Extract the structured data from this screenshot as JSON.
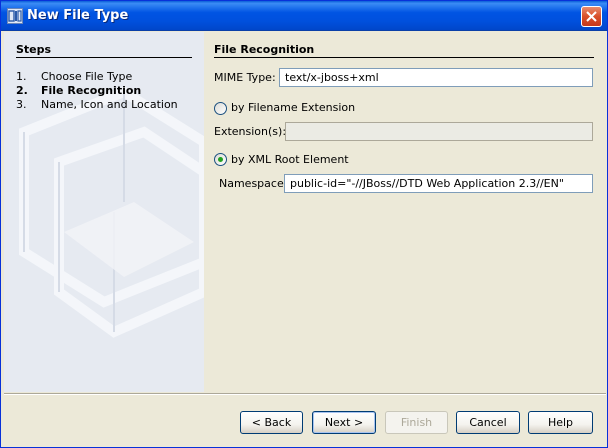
{
  "window": {
    "title": "New File Type"
  },
  "steps": {
    "title": "Steps",
    "items": [
      {
        "num": "1.",
        "label": "Choose File Type",
        "current": false
      },
      {
        "num": "2.",
        "label": "File Recognition",
        "current": true
      },
      {
        "num": "3.",
        "label": "Name, Icon and Location",
        "current": false
      }
    ]
  },
  "main": {
    "title": "File Recognition",
    "mime_label": "MIME Type:",
    "mime_value": "text/x-jboss+xml",
    "by_extension_label": "by Filename Extension",
    "by_extension_selected": false,
    "extensions_label": "Extension(s):",
    "extensions_value": "",
    "by_xml_root_label": "by XML Root Element",
    "by_xml_root_selected": true,
    "namespace_label": "Namespace:",
    "namespace_value": "public-id=\"-//JBoss//DTD Web Application 2.3//EN\""
  },
  "buttons": {
    "back": "< Back",
    "next": "Next >",
    "finish": "Finish",
    "cancel": "Cancel",
    "help": "Help"
  },
  "icons": {
    "app": "netbeans-app-icon",
    "close": "close-icon"
  },
  "colors": {
    "titlebar": "#0054e3",
    "radio_selected": "#21a121"
  }
}
